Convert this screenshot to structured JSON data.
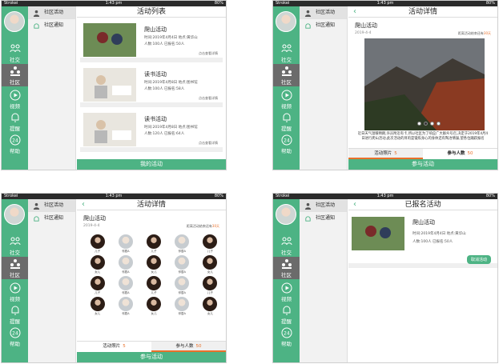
{
  "status": {
    "carrier": "Strokei",
    "time": "1:43 pm",
    "battery": "80%"
  },
  "rail": [
    "社交",
    "社区",
    "视频",
    "提醒",
    "帮助"
  ],
  "sub": [
    "社区活动",
    "社区通知"
  ],
  "list": {
    "title": "活动列表",
    "items": [
      {
        "name": "爬山活动",
        "line1": "时间:2019年4月4日  地点:黄华山",
        "line2": "人数:100人     已报名:50人",
        "link": "点击查看详情"
      },
      {
        "name": "读书活动",
        "line1": "时间:2019年4月8日  地点:图书馆",
        "line2": "人数:100人     已报名:58人",
        "link": "点击查看详情"
      },
      {
        "name": "读书活动",
        "line1": "时间:2019年4月8日  地点:图书馆",
        "line2": "人数:120人     已报名:64人",
        "link": "点击查看详情"
      }
    ],
    "button": "我的活动"
  },
  "detail": {
    "title": "活动详情",
    "name": "爬山活动",
    "date": "2019-4-4",
    "prog_prefix": "距离活动结束还有",
    "prog_value": "30天",
    "para": "近日天气温暖晴朗,许员附近有卡,所以社区为了响应广大群众号召,决定于2019年4月4日进行爬山活动,此次活动的目的是锻炼身心的身体还有陶冶情操,望各位踊跃报名",
    "tab1": "活动照片",
    "tab1n": "5",
    "tab2": "参与人数",
    "tab2n": "50",
    "button": "参与活动"
  },
  "people": [
    "儿子",
    "邻居A",
    "儿子",
    "邻居A",
    "儿子",
    "女儿",
    "邻居A",
    "女儿",
    "邻居A",
    "女儿",
    "儿子",
    "邻居A",
    "儿子",
    "邻居A",
    "儿子",
    "女儿",
    "邻居A",
    "女儿",
    "邻居A",
    "女儿"
  ],
  "reg": {
    "title": "已报名活动",
    "name": "爬山活动",
    "line1": "时间:2019年4月4日  地点:黄华山",
    "line2": "人数:100人     已报名:50人",
    "cancel": "取消活动"
  },
  "colors": {
    "accent": "#4db384",
    "orange": "#e8702a"
  }
}
